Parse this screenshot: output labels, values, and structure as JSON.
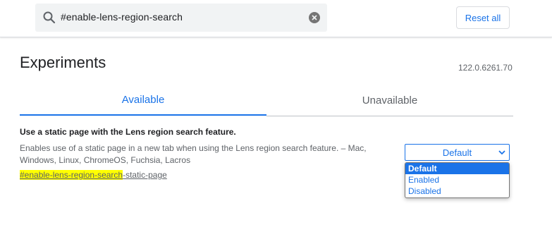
{
  "search": {
    "query": "#enable-lens-region-search"
  },
  "header": {
    "reset_label": "Reset all"
  },
  "page": {
    "title": "Experiments",
    "version": "122.0.6261.70"
  },
  "tabs": [
    {
      "label": "Available",
      "active": true
    },
    {
      "label": "Unavailable",
      "active": false
    }
  ],
  "experiment": {
    "title": "Use a static page with the Lens region search feature.",
    "description": "Enables use of a static page in a new tab when using the Lens region search feature. – Mac, Windows, Linux, ChromeOS, Fuchsia, Lacros",
    "link_highlight": "#enable-lens-region-search",
    "link_rest": "-static-page",
    "select_value": "Default",
    "options": [
      "Default",
      "Enabled",
      "Disabled"
    ],
    "selected_option": "Default"
  },
  "colors": {
    "accent": "#1a73e8",
    "highlight": "#ffff00",
    "search_bg": "#f1f3f4"
  },
  "icons": {
    "search": "search-icon",
    "clear": "clear-icon",
    "dropdown": "chevron-down-icon"
  }
}
